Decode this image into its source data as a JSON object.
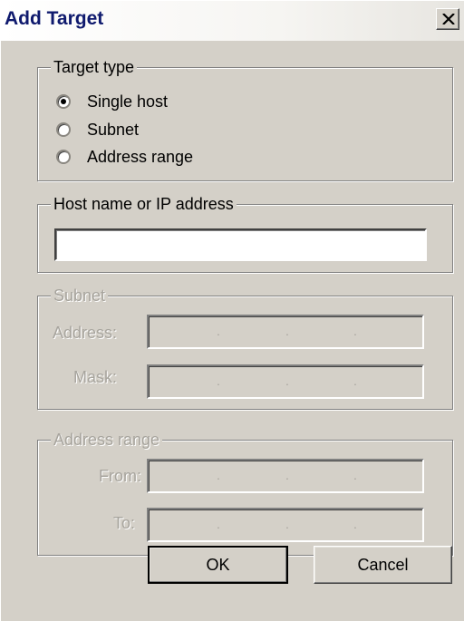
{
  "window": {
    "title": "Add Target",
    "close_icon": "close-icon"
  },
  "target_type": {
    "legend": "Target type",
    "options": [
      {
        "label": "Single host",
        "selected": true
      },
      {
        "label": "Subnet",
        "selected": false
      },
      {
        "label": "Address range",
        "selected": false
      }
    ]
  },
  "host": {
    "legend": "Host name or IP address",
    "value": ""
  },
  "subnet": {
    "legend": "Subnet",
    "address_label": "Address:",
    "mask_label": "Mask:",
    "enabled": false
  },
  "address_range": {
    "legend": "Address range",
    "from_label": "From:",
    "to_label": "To:",
    "enabled": false
  },
  "ip_separator": ".",
  "buttons": {
    "ok": "OK",
    "cancel": "Cancel"
  },
  "colors": {
    "title_text": "#0f1a6e",
    "dialog_bg": "#d4d0c8",
    "disabled_text": "#a7a49d"
  }
}
